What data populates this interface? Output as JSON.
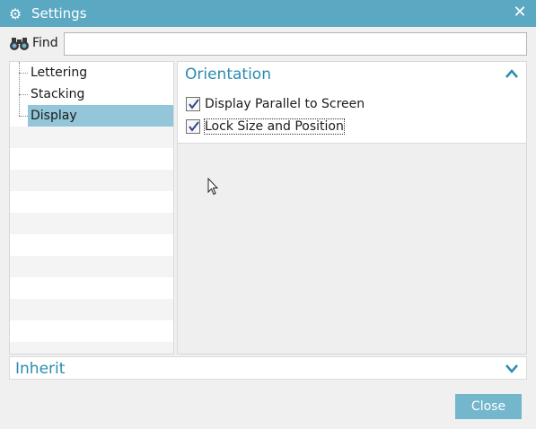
{
  "window": {
    "title": "Settings",
    "icon": "gear-icon",
    "close_glyph": "✕",
    "accent_color": "#5aa8c2"
  },
  "find": {
    "label": "Find",
    "value": "",
    "placeholder": ""
  },
  "tree": {
    "items": [
      {
        "label": "Lettering",
        "selected": false
      },
      {
        "label": "Stacking",
        "selected": false
      },
      {
        "label": "Display",
        "selected": true
      }
    ],
    "selected_color": "#92c6d8"
  },
  "orientation": {
    "title": "Orientation",
    "expanded": true,
    "options": [
      {
        "label": "Display Parallel to Screen",
        "checked": true
      },
      {
        "label": "Lock Size and Position",
        "checked": true
      }
    ]
  },
  "inherit": {
    "title": "Inherit",
    "expanded": false
  },
  "buttons": {
    "close_label": "Close"
  }
}
